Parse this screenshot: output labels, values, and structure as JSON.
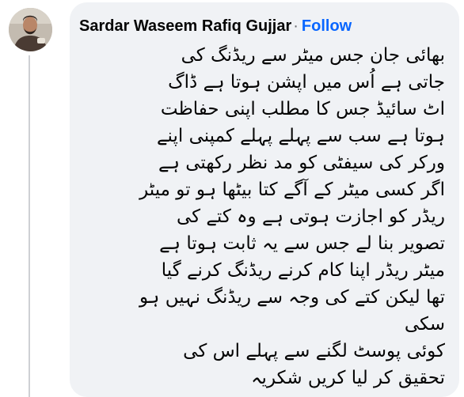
{
  "comment": {
    "author": "Sardar Waseem Rafiq Gujjar",
    "separator": "·",
    "follow_label": "Follow",
    "paragraph_1": "بھائی جان جس میٹر سے ریڈنگ کی\nجاتی ہے اُس میں اپشن ہوتا ہے ڈاگ\nاٹ سائیڈ جس کا مطلب اپنی حفاظت\nہوتا ہے سب سے پہلے پہلے کمپنی اپنے\nورکر کی سیفٹی کو مد نظر رکھتی ہے\nاگر کسی میٹر کے آگے کتا بیٹھا ہو تو میٹر\nریڈر کو اجازت ہوتی ہے وہ کتے کی\nتصویر بنا لے جس سے یہ ثابت ہوتا ہے\nمیٹر ریڈر اپنا کام کرنے ریڈنگ کرنے گیا\nتھا لیکن کتے کی وجہ سے ریڈنگ نہیں ہو\nسکی",
    "paragraph_2": "کوئی پوسٹ لگنے سے پہلے اس کی\nتحقیق کر لیا کریں شکریہ"
  },
  "colors": {
    "bubble_bg": "#f0f2f5",
    "follow": "#0866ff",
    "text": "#050505",
    "thread_line": "#ced0d4"
  }
}
